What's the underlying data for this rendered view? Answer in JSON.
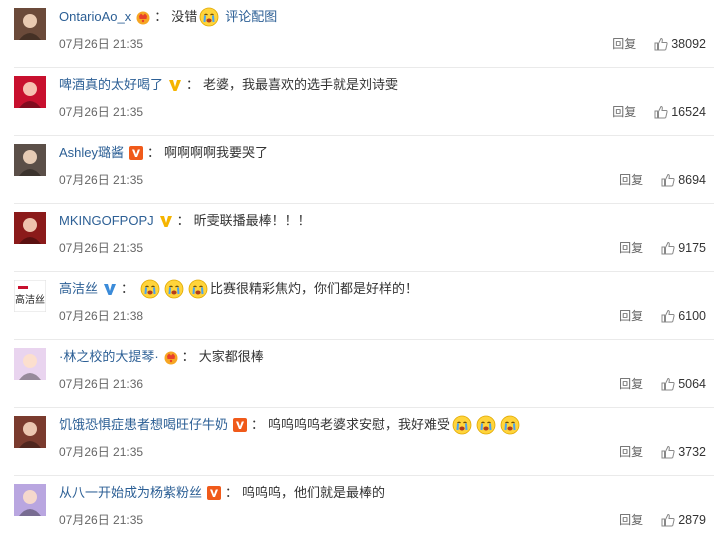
{
  "comments": [
    {
      "username": "OntarioAo_x",
      "badge": "crown-badge",
      "segments": [
        {
          "type": "text",
          "value": "没错"
        },
        {
          "type": "emoji",
          "value": "cry-emoji"
        },
        {
          "type": "link",
          "value": "评论配图"
        }
      ],
      "time": "07月26日 21:35",
      "reply_label": "回复",
      "likes": "38092",
      "avatar_color": "#6b4a3a"
    },
    {
      "username": "啤酒真的太好喝了",
      "badge": "verified-yellow-v",
      "segments": [
        {
          "type": "text",
          "value": "老婆，我最喜欢的选手就是刘诗雯"
        }
      ],
      "time": "07月26日 21:35",
      "reply_label": "回复",
      "likes": "16524",
      "avatar_color": "#c8102e"
    },
    {
      "username": "Ashley璐酱",
      "badge": "vip-orange-v",
      "segments": [
        {
          "type": "text",
          "value": "啊啊啊啊我要哭了"
        }
      ],
      "time": "07月26日 21:35",
      "reply_label": "回复",
      "likes": "8694",
      "avatar_color": "#5b4f48"
    },
    {
      "username": "MKINGOFPOPJ",
      "badge": "verified-yellow-v",
      "segments": [
        {
          "type": "text",
          "value": "昕雯联播最棒！！！"
        }
      ],
      "time": "07月26日 21:35",
      "reply_label": "回复",
      "likes": "9175",
      "avatar_color": "#8b1a1a"
    },
    {
      "username": "高洁丝",
      "badge": "verified-blue-v",
      "segments": [
        {
          "type": "emoji",
          "value": "cry-emoji"
        },
        {
          "type": "emoji",
          "value": "cry-emoji"
        },
        {
          "type": "emoji",
          "value": "cry-emoji"
        },
        {
          "type": "text",
          "value": "比赛很精彩焦灼，你们都是好样的！"
        }
      ],
      "time": "07月26日 21:38",
      "reply_label": "回复",
      "likes": "6100",
      "avatar_color": "#ffffff",
      "avatar_text": "高洁丝"
    },
    {
      "username": "·林之校的大提琴·",
      "badge": "crown-badge",
      "segments": [
        {
          "type": "text",
          "value": "大家都很棒"
        }
      ],
      "time": "07月26日 21:36",
      "reply_label": "回复",
      "likes": "5064",
      "avatar_color": "#e9d4ef"
    },
    {
      "username": "饥饿恐惧症患者想喝旺仔牛奶",
      "badge": "vip-orange-v",
      "segments": [
        {
          "type": "text",
          "value": "呜呜呜呜老婆求安慰，我好难受"
        },
        {
          "type": "emoji",
          "value": "cry-emoji"
        },
        {
          "type": "emoji",
          "value": "cry-emoji"
        },
        {
          "type": "emoji",
          "value": "cry-emoji"
        }
      ],
      "time": "07月26日 21:35",
      "reply_label": "回复",
      "likes": "3732",
      "avatar_color": "#7a3b2e"
    },
    {
      "username": "从八一开始成为杨紫粉丝",
      "badge": "vip-orange-v",
      "segments": [
        {
          "type": "text",
          "value": "呜呜呜，他们就是最棒的"
        }
      ],
      "time": "07月26日 21:35",
      "reply_label": "回复",
      "likes": "2879",
      "avatar_color": "#b9a6e0"
    }
  ]
}
